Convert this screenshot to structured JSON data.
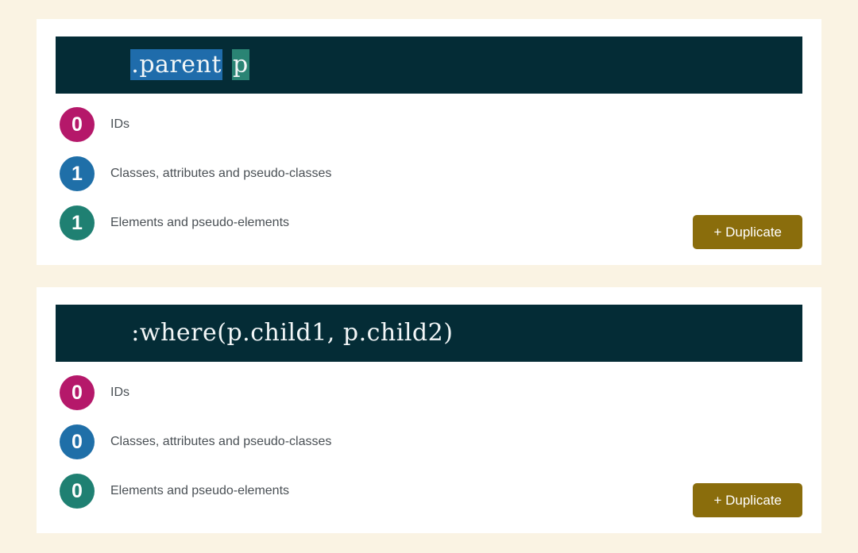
{
  "page": {
    "background_color": "#faf3e3",
    "card_background": "#ffffff"
  },
  "colors": {
    "code_background": "#042c36",
    "ids_badge": "#b5186a",
    "classes_badge": "#1f6fa8",
    "elements_badge": "#1f8072",
    "class_highlight": "#1f6cab",
    "element_highlight": "#2a8474",
    "duplicate_button": "#8a6d0c",
    "label_text": "#4a5055"
  },
  "counter_labels": {
    "ids": "IDs",
    "classes": "Classes, attributes and pseudo-classes",
    "elements": "Elements and pseudo-elements"
  },
  "duplicate_label": "+ Duplicate",
  "cards": [
    {
      "selector_segments": [
        {
          "text": ".parent",
          "kind": "class"
        },
        {
          "text": " ",
          "kind": "plain"
        },
        {
          "text": "p",
          "kind": "element"
        }
      ],
      "selector_text": ".parent p",
      "counts": {
        "ids": "0",
        "classes": "1",
        "elements": "1"
      }
    },
    {
      "selector_segments": [
        {
          "text": ":where(p.child1, p.child2)",
          "kind": "plain"
        }
      ],
      "selector_text": ":where(p.child1, p.child2)",
      "counts": {
        "ids": "0",
        "classes": "0",
        "elements": "0"
      }
    }
  ]
}
